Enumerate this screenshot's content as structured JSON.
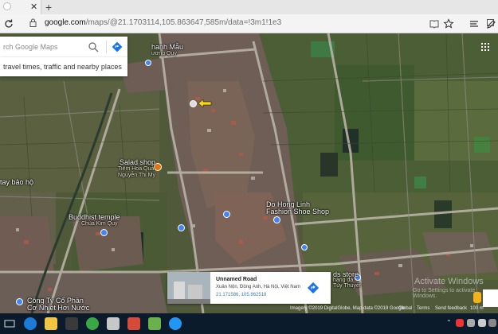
{
  "browser": {
    "tab_close": "✕",
    "new_tab": "+",
    "url_host": "google.com",
    "url_rest": "/maps/@21.1703114,105.863647,585m/data=!3m1!1e3"
  },
  "search": {
    "placeholder": "rch Google Maps",
    "suggestion": "travel times, traffic and nearby places"
  },
  "places": [
    {
      "text": "hanh Mẫu",
      "cls": ""
    },
    {
      "text": "ương Quý",
      "cls": "small"
    },
    {
      "text": "Salad shop",
      "cls": ""
    },
    {
      "text": "Tiệm Hoa Quả",
      "cls": "small"
    },
    {
      "text": "Nguyễn Thị My",
      "cls": "small"
    },
    {
      "text": "tay bảo hộ",
      "cls": ""
    },
    {
      "text": "Buddhist temple",
      "cls": ""
    },
    {
      "text": "Chùa Kim Quy",
      "cls": "small"
    },
    {
      "text": "Do Hong Linh",
      "cls": ""
    },
    {
      "text": "Fashion Shoe Shop",
      "cls": ""
    },
    {
      "text": "ds store",
      "cls": ""
    },
    {
      "text": "hàng đá",
      "cls": "small"
    },
    {
      "text": "Tùy Thuyết",
      "cls": "small"
    },
    {
      "text": "Công Ty Cổ Phần",
      "cls": ""
    },
    {
      "text": "Cơ Nhiệt Hơi Nước",
      "cls": ""
    }
  ],
  "card": {
    "title": "Unnamed Road",
    "address": "Xuân Nộn, Đông Anh, Hà Nội, Việt Nam",
    "coords": "21.171586, 105.862518"
  },
  "footer": {
    "imagery": "Imagery ©2019 DigitalGlobe, Map data ©2019 Google",
    "global": "Global",
    "terms": "Terms",
    "feedback": "Send feedback",
    "scale": "100 m"
  },
  "watermark": {
    "title": "Activate Windows",
    "subtitle": "Go to Settings to activate Windows."
  },
  "colors": {
    "accent": "#1a73e8",
    "pin_orange": "#e8710a",
    "pin_blue": "#4285f4",
    "taskbar": "#0b1b2b"
  }
}
